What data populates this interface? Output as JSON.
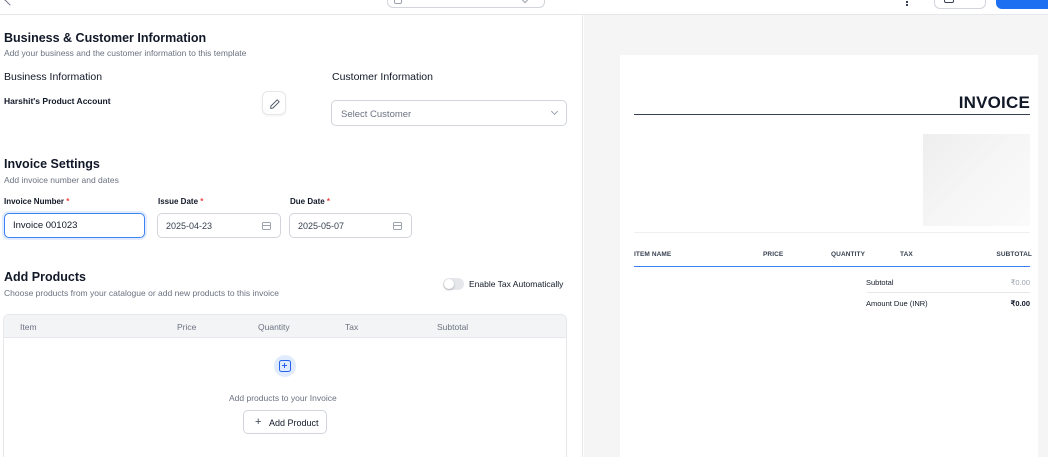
{
  "business_customer": {
    "title": "Business & Customer Information",
    "subtitle": "Add your business and the customer information to this template",
    "business_heading": "Business Information",
    "business_name": "Harshit's Product Account",
    "customer_heading": "Customer Information",
    "customer_placeholder": "Select Customer"
  },
  "invoice_settings": {
    "title": "Invoice Settings",
    "subtitle": "Add invoice number and dates",
    "number_label": "Invoice Number",
    "number_value": "Invoice 001023",
    "issue_label": "Issue Date",
    "issue_value": "2025-04-23",
    "due_label": "Due Date",
    "due_value": "2025-05-07",
    "required_mark": "*"
  },
  "products": {
    "title": "Add Products",
    "subtitle": "Choose products from your catalogue or add new products to this invoice",
    "tax_toggle_label": "Enable Tax Automatically",
    "tax_toggle_on": false,
    "columns": [
      "Item",
      "Price",
      "Quantity",
      "Tax",
      "Subtotal"
    ],
    "empty_text": "Add products to your Invoice",
    "add_button": "Add Product",
    "add_plus": "+"
  },
  "preview": {
    "title": "INVOICE",
    "columns": [
      "ITEM NAME",
      "PRICE",
      "QUANTITY",
      "TAX",
      "SUBTOTAL"
    ],
    "subtotal_label": "Subtotal",
    "subtotal_value": "₹0.00",
    "amount_due_label": "Amount Due (INR)",
    "amount_due_value": "₹0.00"
  },
  "colors": {
    "accent": "#1d6ff2",
    "focus": "#3b82f6",
    "required": "#ef4444",
    "preview_bg": "#f5f5f5"
  },
  "icons": {
    "edit": "pencil-icon",
    "calendar": "calendar-icon",
    "add_product": "plus-square-icon",
    "select_chevron": "chevron-down-icon"
  }
}
